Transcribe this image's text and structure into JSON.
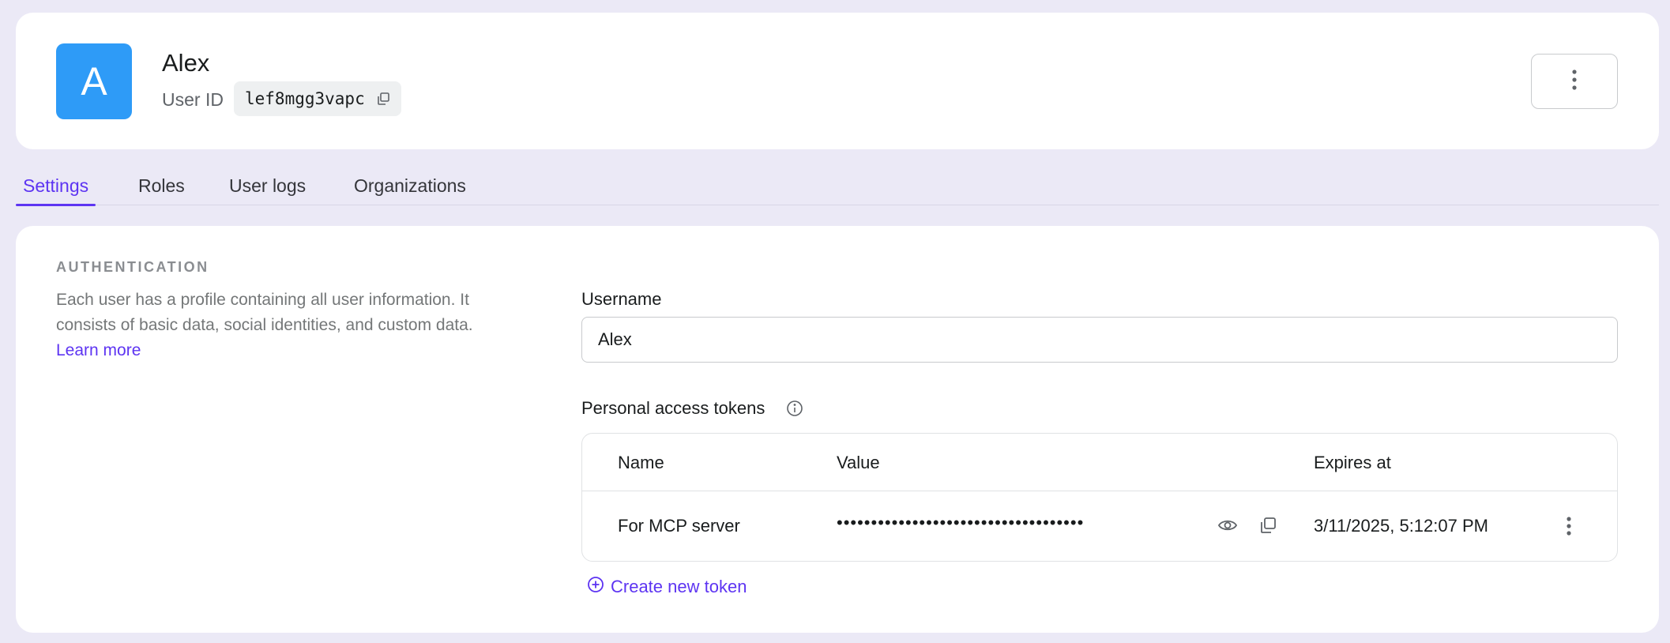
{
  "user": {
    "avatar_letter": "A",
    "name": "Alex",
    "id_label": "User ID",
    "id_value": "lef8mgg3vapc"
  },
  "tabs": [
    {
      "label": "Settings",
      "active": true
    },
    {
      "label": "Roles",
      "active": false
    },
    {
      "label": "User logs",
      "active": false
    },
    {
      "label": "Organizations",
      "active": false
    }
  ],
  "authentication": {
    "title": "AUTHENTICATION",
    "description": "Each user has a profile containing all user information. It consists of basic data, social identities, and custom data.",
    "learn_more": "Learn more"
  },
  "username": {
    "label": "Username",
    "value": "Alex"
  },
  "tokens": {
    "label": "Personal access tokens",
    "columns": {
      "name": "Name",
      "value": "Value",
      "expires": "Expires at"
    },
    "rows": [
      {
        "name": "For MCP server",
        "value": "••••••••••••••••••••••••••••••••••••",
        "expires": "3/11/2025, 5:12:07 PM"
      }
    ],
    "create_label": "Create new token"
  },
  "colors": {
    "accent": "#5d34f2",
    "avatar": "#2e9bf7",
    "background": "#ebe9f6"
  },
  "icons": [
    "copy-icon",
    "more-vertical-icon",
    "info-icon",
    "eye-icon",
    "plus-circle-icon"
  ]
}
